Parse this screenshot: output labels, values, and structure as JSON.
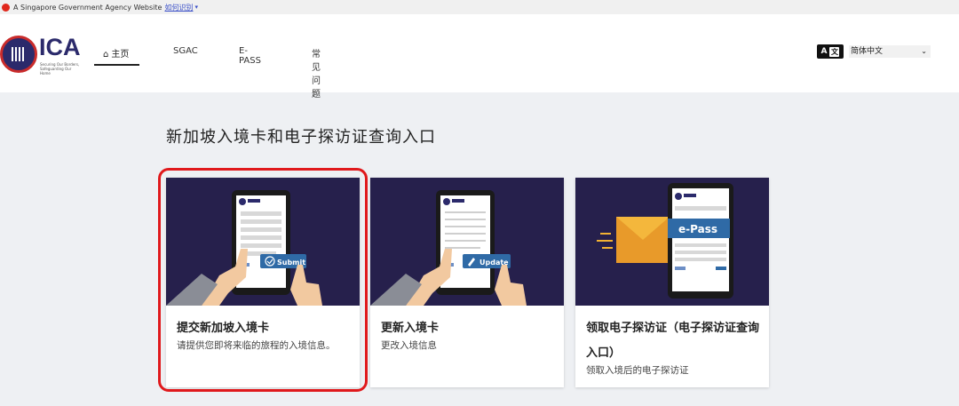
{
  "gov_banner": {
    "text": "A Singapore Government Agency Website",
    "link": "如何识别"
  },
  "header": {
    "logo_text": "ICA",
    "logo_tagline": "Securing Our Borders, Safeguarding Our Home",
    "nav": [
      {
        "label": "主页",
        "active": true,
        "icon": "home-icon"
      },
      {
        "label": "SGAC"
      },
      {
        "label": "E-PASS"
      },
      {
        "label": "常见问题"
      }
    ],
    "language_selected": "简体中文"
  },
  "page_title": "新加坡入境卡和电子探访证查询入口",
  "cards": [
    {
      "title": "提交新加坡入境卡",
      "description": "请提供您即将来临的旅程的入境信息。",
      "illustration": "phone-submit",
      "badge": "Submit",
      "highlighted": true
    },
    {
      "title": "更新入境卡",
      "description": "更改入境信息",
      "illustration": "phone-update",
      "badge": "Update"
    },
    {
      "title": "领取电子探访证（电子探访证查询入口）",
      "description": "领取入境后的电子探访证",
      "illustration": "phone-epass",
      "badge": "e-Pass"
    }
  ],
  "colors": {
    "brand": "#2b2a6b",
    "card_image_bg": "#26204c",
    "badge_blue": "#2f6aa6",
    "highlight": "#e0191c",
    "seal_red": "#c92b2b"
  }
}
